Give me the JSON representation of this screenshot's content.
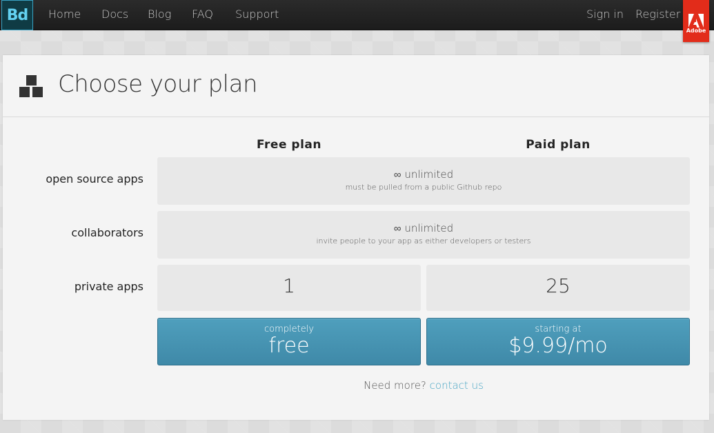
{
  "nav": {
    "logo": "Bd",
    "links": [
      "Home",
      "Docs",
      "Blog",
      "FAQ",
      "Support"
    ],
    "right_links": [
      "Sign in",
      "Register"
    ],
    "adobe_label": "Adobe"
  },
  "page": {
    "title": "Choose your plan"
  },
  "plans": {
    "columns": [
      "Free plan",
      "Paid plan"
    ],
    "rows": [
      {
        "label": "open source apps",
        "shared": {
          "main": "∞ unlimited",
          "sub": "must be pulled from a public Github repo"
        }
      },
      {
        "label": "collaborators",
        "shared": {
          "main": "∞ unlimited",
          "sub": "invite people to your app as either developers or testers"
        }
      },
      {
        "label": "private apps",
        "values": [
          "1",
          "25"
        ]
      }
    ],
    "free_button": {
      "small": "completely",
      "large": "free"
    },
    "paid_button": {
      "small": "starting at",
      "large": "$9.99/mo"
    }
  },
  "footer": {
    "need_more": "Need more?",
    "contact": "contact us"
  },
  "colors": {
    "accent": "#4aa6c4",
    "button": "#4592b1",
    "adobe_red": "#e22c1a",
    "nav_bg": "#222222"
  }
}
